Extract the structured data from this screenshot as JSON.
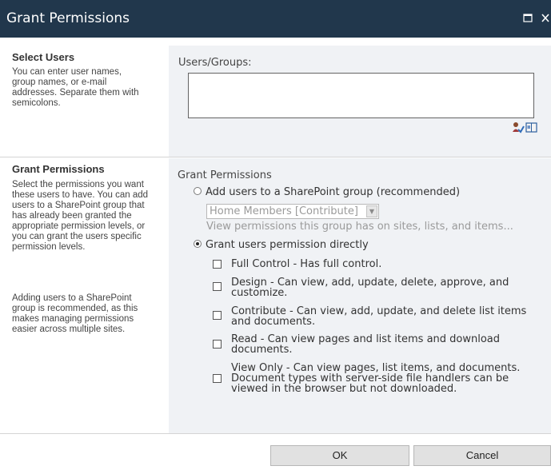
{
  "dialog": {
    "title": "Grant Permissions"
  },
  "icons": {
    "maximize": "maximize-icon",
    "close": "close-icon",
    "check_names": "check-names-icon",
    "browse": "address-book-icon"
  },
  "select_users": {
    "heading": "Select Users",
    "description": "You can enter user names, group names, or e-mail addresses. Separate them with semicolons.",
    "field_label": "Users/Groups:",
    "value": ""
  },
  "grant_permissions": {
    "heading": "Grant Permissions",
    "description_1": "Select the permissions you want these users to have. You can add users to a SharePoint group that has already been granted the appropriate permission levels, or you can grant the users specific permission levels.",
    "description_2": "Adding users to a SharePoint group is recommended, as this makes managing permissions easier across multiple sites.",
    "field_label": "Grant Permissions",
    "option_group": {
      "label": "Add users to a SharePoint group (recommended)",
      "selected": false,
      "select_value": "Home Members [Contribute]",
      "hint": "View permissions this group has on sites, lists, and items..."
    },
    "option_direct": {
      "label": "Grant users permission directly",
      "selected": true
    },
    "levels": [
      {
        "label": "Full Control - Has full control.",
        "checked": false
      },
      {
        "label": "Design - Can view, add, update, delete, approve, and\ncustomize.",
        "checked": false
      },
      {
        "label": "Contribute - Can view, add, update, and delete list items\nand documents.",
        "checked": false
      },
      {
        "label": "Read - Can view pages and list items and download\ndocuments.",
        "checked": false
      },
      {
        "label": "View Only - Can view pages, list items, and documents.\nDocument types with server-side file handlers can be\nviewed in the browser but not downloaded.",
        "checked": false
      }
    ]
  },
  "buttons": {
    "ok": "OK",
    "cancel": "Cancel"
  }
}
